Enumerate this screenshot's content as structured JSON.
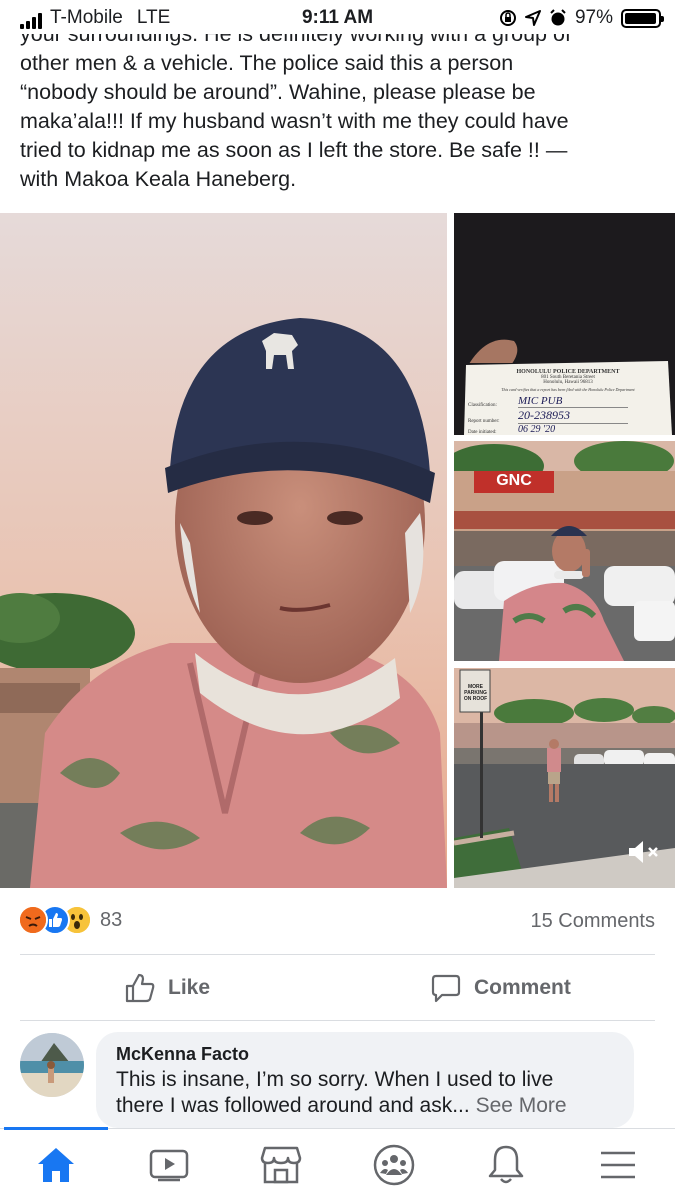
{
  "status_bar": {
    "carrier": "T-Mobile",
    "network": "LTE",
    "time": "9:11 AM",
    "battery": "97%",
    "battery_level": 0.97
  },
  "post": {
    "text_lines": [
      "your surroundings. He is definitely working with a group of",
      "other men & a vehicle. The police said this a person",
      "“nobody should be around”. Wahine, please please be",
      "maka’ala!!! If my husband wasn’t with me they could have",
      "tried to kidnap me as soon as I left the store. Be safe !! —",
      "with Makoa Keala Haneberg."
    ],
    "police_card": {
      "department": "HONOLULU POLICE DEPARTMENT",
      "address_1": "801 South Beretania Street",
      "address_2": "Honolulu, Hawaii 96813",
      "note": "This card verifies that a report has been filed with the Honolulu Police Department",
      "classification_label": "Classification:",
      "classification_value": "MIC PUB",
      "report_label": "Report number:",
      "report_value": "20-238953",
      "date_label": "Date initiated:",
      "date_value": "06 29 '20"
    },
    "store_sign": "GNC",
    "parking_sign": [
      "MORE",
      "PARKING",
      "ON ROOF"
    ]
  },
  "engagement": {
    "reaction_count": "83",
    "comments_count": "15 Comments",
    "like_label": "Like",
    "comment_label": "Comment"
  },
  "comment": {
    "author": "McKenna Facto",
    "text_line_1": "This is insane, I’m so sorry. When I used to live",
    "text_line_2": "there I was followed around and ask...",
    "see_more": "See More"
  },
  "nav": {
    "active": "home",
    "accent": "#1877f2"
  }
}
